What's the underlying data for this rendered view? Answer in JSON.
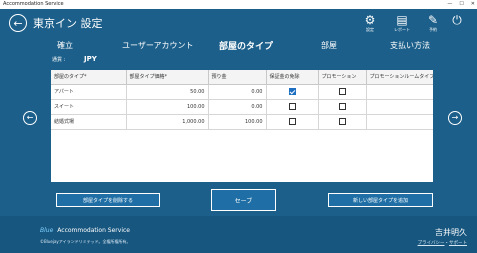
{
  "window": {
    "title": "Accommodation Service",
    "controls": [
      "—",
      "☐",
      "✕"
    ]
  },
  "header": {
    "back_icon": "←",
    "title": "東京イン 設定",
    "buttons": [
      {
        "icon": "⚙",
        "label": "設定"
      },
      {
        "icon": "▤",
        "label": "レポート"
      },
      {
        "icon": "✎",
        "label": "予約"
      },
      {
        "icon": "⏻",
        "label": ""
      }
    ]
  },
  "tabs": [
    {
      "label": "確立",
      "active": false
    },
    {
      "label": "ユーザーアカウント",
      "active": false
    },
    {
      "label": "部屋のタイプ",
      "active": true
    },
    {
      "label": "部屋",
      "active": false
    },
    {
      "label": "支払い方法",
      "active": false
    }
  ],
  "currency": {
    "label": "通貨 :",
    "value": "JPY"
  },
  "grid": {
    "columns": [
      "部屋のタイプ*",
      "部屋タイプ価格*",
      "預り金",
      "保証金の免除",
      "プロモーション",
      "プロモーションルームタイプI"
    ],
    "rows": [
      {
        "type": "アパート",
        "price": "50.00",
        "deposit": "0.00",
        "waiver": true,
        "promotion": false,
        "promo_type": ""
      },
      {
        "type": "スイート",
        "price": "100.00",
        "deposit": "0.00",
        "waiver": false,
        "promotion": false,
        "promo_type": ""
      },
      {
        "type": "結婚式場",
        "price": "1,000.00",
        "deposit": "100.00",
        "waiver": false,
        "promotion": false,
        "promo_type": ""
      }
    ]
  },
  "nav": {
    "left_icon": "←",
    "right_icon": "→"
  },
  "buttons": {
    "delete": "部屋タイプを削除する",
    "save": "セーブ",
    "add": "新しい部屋タイプを追加"
  },
  "footer": {
    "logo_mark": "Blue",
    "product": "Accommodation Service",
    "copyright": "©Bluejayアイランドリミテッド。全権所権所有。",
    "user": "吉井明久",
    "privacy": "プライバシー",
    "separator": "・",
    "support": "サポート"
  },
  "colors": {
    "background": "#1c5f8a",
    "footer": "#17567f",
    "button": "#1f6fa6",
    "checkbox_on": "#1e6fc1"
  }
}
